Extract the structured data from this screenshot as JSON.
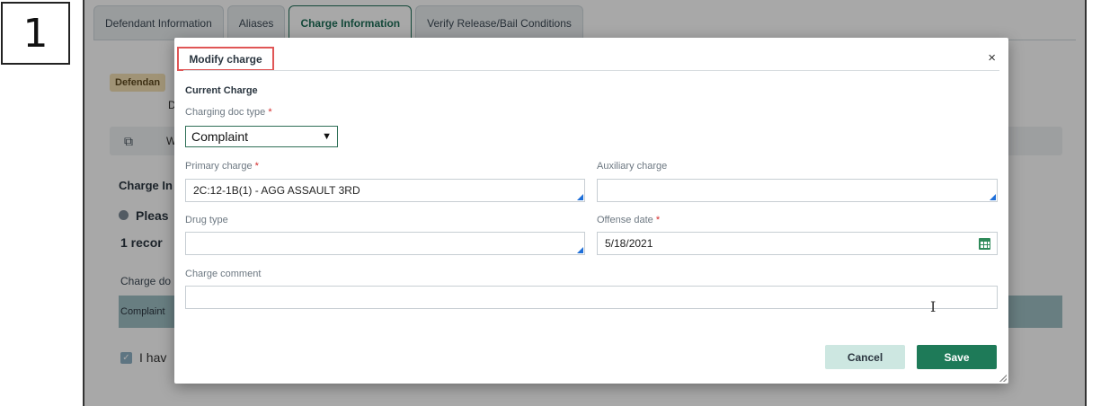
{
  "step_number": "1",
  "tabs": [
    {
      "label": "Defendant Information"
    },
    {
      "label": "Aliases"
    },
    {
      "label": "Charge Information",
      "active": true
    },
    {
      "label": "Verify Release/Bail Conditions"
    }
  ],
  "background": {
    "badge": "Defendan",
    "d_text": "D",
    "toolbar_w": "W",
    "charge_info": "Charge In",
    "please": "Pleas",
    "records": "1 recor",
    "charge_doc": "Charge do",
    "row_text": "Complaint",
    "checkbox_text": "I hav"
  },
  "modal": {
    "title": "Modify charge",
    "section": "Current Charge",
    "charging_doc_type": {
      "label": "Charging doc type",
      "required": "*",
      "value": "Complaint"
    },
    "primary_charge": {
      "label": "Primary charge",
      "required": "*",
      "value": "2C:12-1B(1) - AGG ASSAULT 3RD"
    },
    "auxiliary_charge": {
      "label": "Auxiliary charge",
      "value": ""
    },
    "drug_type": {
      "label": "Drug type",
      "value": ""
    },
    "offense_date": {
      "label": "Offense date",
      "required": "*",
      "value": "5/18/2021"
    },
    "charge_comment": {
      "label": "Charge comment",
      "value": ""
    },
    "cancel_label": "Cancel",
    "save_label": "Save",
    "close_label": "×"
  },
  "colors": {
    "accent": "#1e7a58",
    "highlight_border": "#e05656",
    "required": "#d42b2b"
  }
}
